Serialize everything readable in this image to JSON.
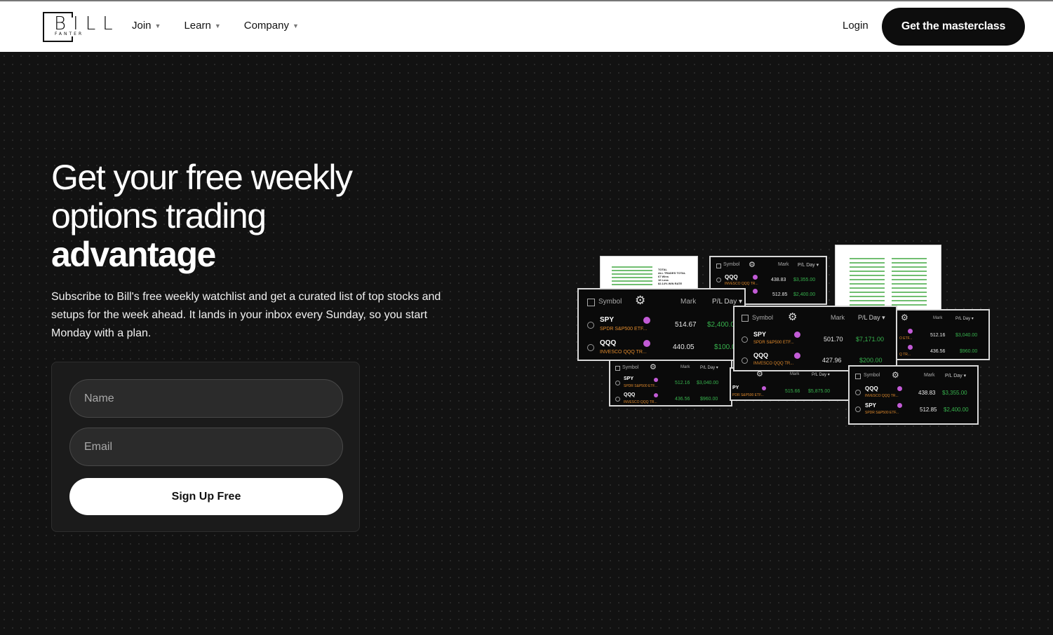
{
  "brand": {
    "logo_text": "BILL",
    "logo_sub": "FANTER"
  },
  "nav": {
    "items": [
      {
        "label": "Join"
      },
      {
        "label": "Learn"
      },
      {
        "label": "Company"
      }
    ],
    "login": "Login",
    "cta": "Get the masterclass"
  },
  "hero": {
    "title_line1": "Get your free weekly",
    "title_line2": "options trading",
    "title_strong": "advantage",
    "description": "Subscribe to Bill's free weekly watchlist and get a curated list of top stocks and setups for the week ahead. It lands in your inbox every Sunday, so you start Monday with a plan."
  },
  "form": {
    "name_placeholder": "Name",
    "email_placeholder": "Email",
    "submit_label": "Sign Up Free"
  },
  "illustration": {
    "headers": {
      "symbol": "Symbol",
      "mark": "Mark",
      "pl": "P/L Day ▾"
    },
    "main_left": [
      {
        "symbol": "SPY",
        "name": "SPDR S&P500 ETF...",
        "mark": "514.67",
        "pl": "$2,400.0"
      },
      {
        "symbol": "QQQ",
        "name": "INVESCO QQQ TR...",
        "mark": "440.05",
        "pl": "$100.0"
      }
    ],
    "main_center": [
      {
        "symbol": "SPY",
        "name": "SPDR S&P500 ETF...",
        "mark": "501.70",
        "pl": "$7,171.00"
      },
      {
        "symbol": "QQQ",
        "name": "INVESCO QQQ TR...",
        "mark": "427.96",
        "pl": "$200.00"
      }
    ],
    "top_center": [
      {
        "symbol": "QQQ",
        "name": "INVESCO QQQ TR...",
        "mark": "438.83",
        "pl": "$3,355.00"
      },
      {
        "symbol": "",
        "name": "",
        "mark": "512.85",
        "pl": "$2,400.00"
      }
    ],
    "bottom_left": [
      {
        "symbol": "SPY",
        "name": "SPDR S&P500 ETF...",
        "mark": "512.16",
        "pl": "$3,040.00"
      },
      {
        "symbol": "QQQ",
        "name": "INVESCO QQQ TR...",
        "mark": "436.56",
        "pl": "$960.00"
      }
    ],
    "bottom_mid": [
      {
        "symbol": "PY",
        "name": "PDR S&P500 ETF...",
        "mark": "515.66",
        "pl": "$5,875.00"
      }
    ],
    "right_mid": [
      {
        "mark": "512.16",
        "pl": "$3,040.00",
        "name": "O ETF..."
      },
      {
        "mark": "436.56",
        "pl": "$960.00",
        "name": "Q TR..."
      }
    ],
    "bottom_right": [
      {
        "symbol": "QQQ",
        "name": "INVESCO QQQ TR...",
        "mark": "438.83",
        "pl": "$3,355.00"
      },
      {
        "symbol": "SPY",
        "name": "SPDR S&P500 ETF...",
        "mark": "512.85",
        "pl": "$2,400.00"
      }
    ],
    "paper_note": {
      "l1": "TOTAL",
      "l2": "ALL TRADES TOTAL",
      "l3": "67 Wins",
      "l4": "16 Loss",
      "l5": "82.14% WIN RATE"
    }
  }
}
